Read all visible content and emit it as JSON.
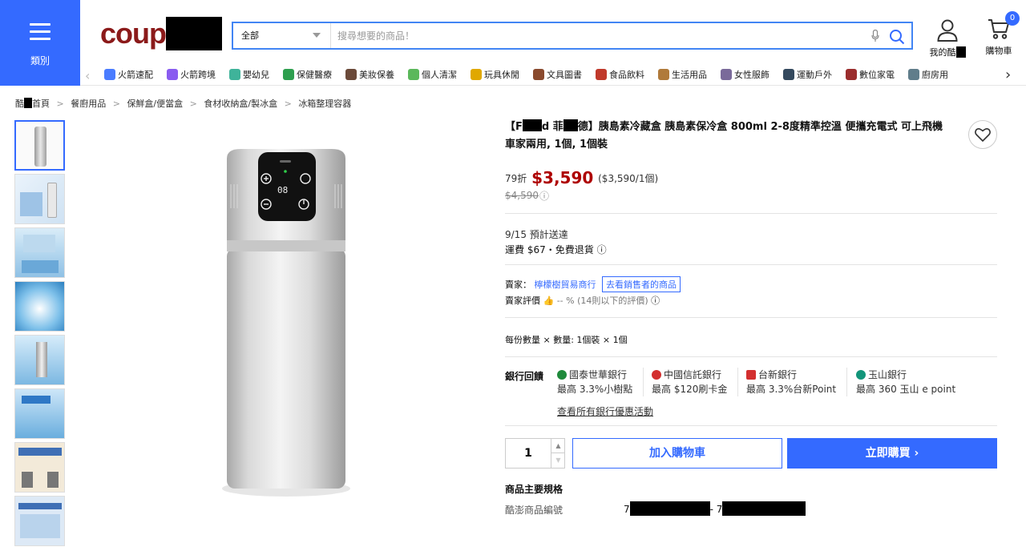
{
  "header": {
    "category_label": "類別",
    "logo_text": "coup",
    "search": {
      "category": "全部",
      "placeholder": "搜尋想要的商品！"
    },
    "my_account_label": "我的酷",
    "cart_label": "購物車",
    "cart_count": "0"
  },
  "catnav": {
    "items": [
      {
        "label": "火箭速配",
        "color": "#4a7cff"
      },
      {
        "label": "火箭跨境",
        "color": "#8a5cf0"
      },
      {
        "label": "嬰幼兒",
        "color": "#3fb39a"
      },
      {
        "label": "保健醫療",
        "color": "#2e9f4f"
      },
      {
        "label": "美妝保養",
        "color": "#6b4a3a"
      },
      {
        "label": "個人清潔",
        "color": "#5bb85b"
      },
      {
        "label": "玩具休閒",
        "color": "#e0a800"
      },
      {
        "label": "文具圖書",
        "color": "#8a4a2e"
      },
      {
        "label": "食品飲料",
        "color": "#c0392b"
      },
      {
        "label": "生活用品",
        "color": "#b07a3a"
      },
      {
        "label": "女性服飾",
        "color": "#7a6a9a"
      },
      {
        "label": "運動戶外",
        "color": "#34495e"
      },
      {
        "label": "數位家電",
        "color": "#9b2d2d"
      },
      {
        "label": "廚房用",
        "color": "#607d8b"
      }
    ]
  },
  "breadcrumb": {
    "home": "首頁",
    "home_prefix": "酷",
    "items": [
      "餐廚用品",
      "保鮮盒/便當盒",
      "食材收納盒/製冰盒",
      "冰箱整理容器"
    ]
  },
  "product": {
    "title_parts": [
      "【F",
      "d 菲",
      "德】胰島素冷藏盒 胰島素保冷盒 800ml 2-8度精準控溫 便攜充電式 可上飛機 車家兩用, 1個, 1個裝"
    ],
    "discount": "79折",
    "price": "$3,590",
    "unit_price": "($3,590/1個)",
    "original_price": "$4,590",
    "delivery": "9/15 預計送達",
    "shipping": "運費 $67・免費退貨",
    "seller_label": "賣家：",
    "seller_name": "檸檬樹貿易商行",
    "seller_link": "去看銷售者的商品",
    "rating_label": "賣家評價",
    "rating_value": "-- % (14則以下的評價)",
    "pack_label": "每份數量 × 數量: 1個裝 × 1個"
  },
  "banks": {
    "label": "銀行回饋",
    "items": [
      {
        "name": "國泰世華銀行",
        "detail": "最高 3.3%小樹點",
        "color": "#1f8a3b"
      },
      {
        "name": "中國信託銀行",
        "detail": "最高 $120刷卡金",
        "color": "#d32f2f"
      },
      {
        "name": "台新銀行",
        "detail": "最高 3.3%台新Point",
        "color": "#d32f2f"
      },
      {
        "name": "玉山銀行",
        "detail": "最高 360 玉山 e point",
        "color": "#12957a"
      }
    ],
    "view_all": "查看所有銀行優惠活動"
  },
  "purchase": {
    "quantity": "1",
    "add_to_cart": "加入購物車",
    "buy_now": "立即購買"
  },
  "specs": {
    "heading": "商品主要規格",
    "key": "酷澎商品編號",
    "value_prefix": "7",
    "value_mid": "- 7"
  },
  "colors": {
    "accent": "#346aff",
    "price": "#ae0000"
  }
}
